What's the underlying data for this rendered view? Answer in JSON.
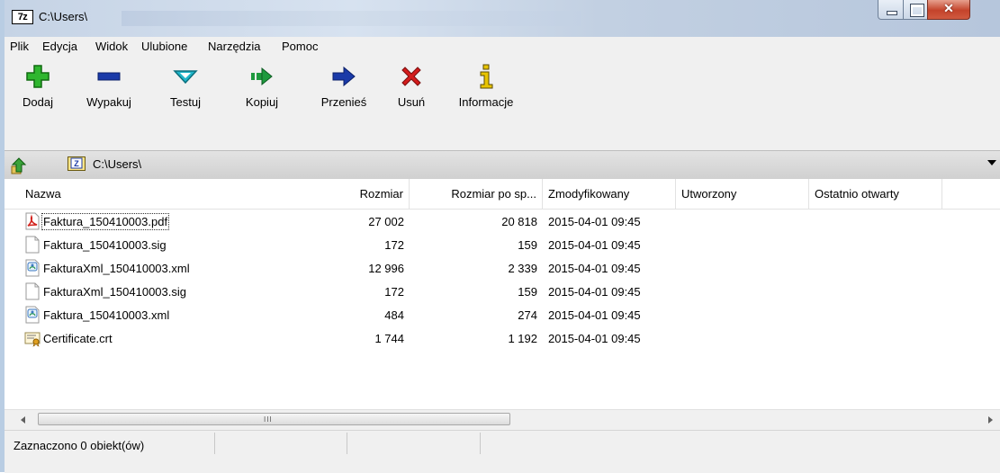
{
  "window": {
    "title": "C:\\Users\\",
    "app_icon_label": "7z"
  },
  "menu": [
    "Plik",
    "Edycja",
    "Widok",
    "Ulubione",
    "Narzędzia",
    "Pomoc"
  ],
  "toolbar": [
    {
      "label": "Dodaj",
      "icon": "add-icon"
    },
    {
      "label": "Wypakuj",
      "icon": "extract-icon"
    },
    {
      "label": "Testuj",
      "icon": "test-icon"
    },
    {
      "label": "Kopiuj",
      "icon": "copy-icon"
    },
    {
      "label": "Przenieś",
      "icon": "move-icon"
    },
    {
      "label": "Usuń",
      "icon": "delete-icon"
    },
    {
      "label": "Informacje",
      "icon": "info-icon"
    }
  ],
  "address": {
    "path": "C:\\Users\\"
  },
  "columns": [
    "Nazwa",
    "Rozmiar",
    "Rozmiar po sp...",
    "Zmodyfikowany",
    "Utworzony",
    "Ostatnio otwarty"
  ],
  "files": [
    {
      "name": "Faktura_150410003.pdf",
      "size": "27 002",
      "packed": "20 818",
      "modified": "2015-04-01 09:45",
      "icon": "pdf-file-icon"
    },
    {
      "name": "Faktura_150410003.sig",
      "size": "172",
      "packed": "159",
      "modified": "2015-04-01 09:45",
      "icon": "blank-file-icon"
    },
    {
      "name": "FakturaXml_150410003.xml",
      "size": "12 996",
      "packed": "2 339",
      "modified": "2015-04-01 09:45",
      "icon": "xml-file-icon"
    },
    {
      "name": "FakturaXml_150410003.sig",
      "size": "172",
      "packed": "159",
      "modified": "2015-04-01 09:45",
      "icon": "blank-file-icon"
    },
    {
      "name": "Faktura_150410003.xml",
      "size": "484",
      "packed": "274",
      "modified": "2015-04-01 09:45",
      "icon": "xml-file-icon"
    },
    {
      "name": "Certificate.crt",
      "size": "1 744",
      "packed": "1 192",
      "modified": "2015-04-01 09:45",
      "icon": "certificate-file-icon"
    }
  ],
  "scrollbar": {
    "grip": "III"
  },
  "status": {
    "text": "Zaznaczono 0 obiekt(ów)"
  },
  "colors": {
    "add": "#2fb62f",
    "extract": "#1a3aa8",
    "test": "#1fb5c9",
    "copy": "#1e9a3e",
    "move": "#1a3aa8",
    "delete": "#d41c1c",
    "info": "#c8a800"
  }
}
